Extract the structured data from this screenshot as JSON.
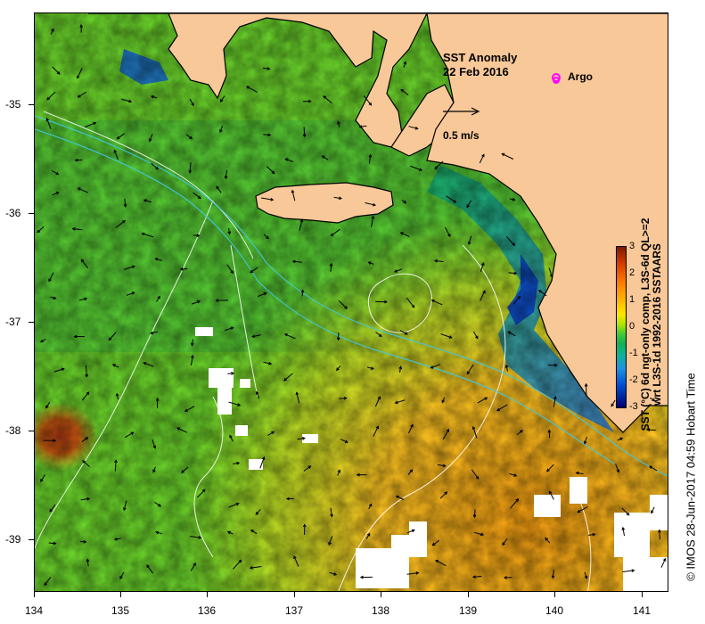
{
  "title": {
    "line1": "SST Anomaly",
    "line2": "22 Feb 2016"
  },
  "scale_arrow_label": "0.5 m/s",
  "argo_legend": {
    "label": "Argo",
    "marker_color": "#ff00ff"
  },
  "colorbar": {
    "ticks": [
      "3",
      "2",
      "1",
      "0",
      "-1",
      "-2",
      "-3"
    ],
    "caption_line1": "SST (°C) 6d ngt-only comp, L3S-6d QL>=2",
    "caption_line2": "wrt L3S-1d 1992-2016 SSTAARS",
    "range": [
      -3,
      3
    ]
  },
  "credit": "© IMOS 28-Jun-2017 04:59 Hobart Time",
  "axes": {
    "x_ticks": [
      "134",
      "135",
      "136",
      "137",
      "138",
      "139",
      "140",
      "141"
    ],
    "y_ticks": [
      "-35",
      "-36",
      "-37",
      "-38",
      "-39"
    ],
    "xlim": [
      134,
      141.3
    ],
    "ylim": [
      -39.5,
      -34.2
    ]
  },
  "colors": {
    "land": "#f8c898",
    "coastline": "#000000",
    "ocean_base": "#6ad22a",
    "contour_white": "#ffffff",
    "contour_cyan": "#40c8e0"
  }
}
